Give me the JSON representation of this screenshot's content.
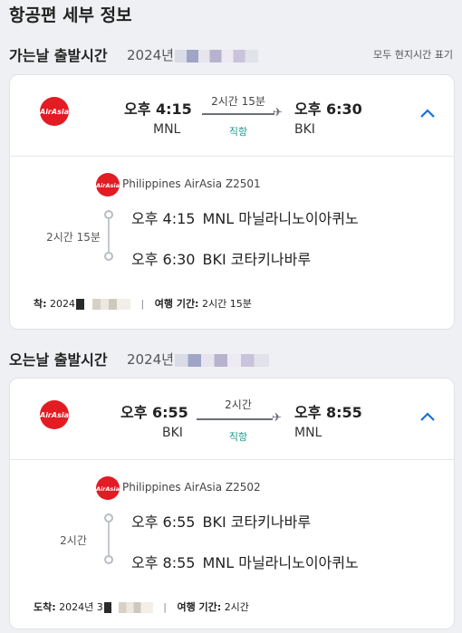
{
  "page": {
    "title": "항공편 세부 정보"
  },
  "timezone_note": "모두 현지시간 표기",
  "outbound": {
    "section_label": "가는날 출발시간",
    "date_visible": "2024년",
    "summary": {
      "dep_time": "오후 4:15",
      "dep_code": "MNL",
      "duration": "2시간 15분",
      "stops": "직항",
      "arr_time": "오후 6:30",
      "arr_code": "BKI"
    },
    "detail": {
      "airline": "Philippines AirAsia Z2501",
      "duration": "2시간 15분",
      "dep_time": "오후 4:15",
      "dep_place": "MNL 마닐라니노이아퀴노",
      "arr_time": "오후 6:30",
      "arr_place": "BKI 코타키나바루",
      "arrival_label": "착:",
      "arrival_date": "2024",
      "travel_label": "여행 기간:",
      "travel_time": "2시간 15분"
    }
  },
  "inbound": {
    "section_label": "오는날 출발시간",
    "date_visible": "2024년",
    "summary": {
      "dep_time": "오후 6:55",
      "dep_code": "BKI",
      "duration": "2시간",
      "stops": "직항",
      "arr_time": "오후 8:55",
      "arr_code": "MNL"
    },
    "detail": {
      "airline": "Philippines AirAsia Z2502",
      "duration": "2시간",
      "dep_time": "오후 6:55",
      "dep_place": "BKI 코타키나바루",
      "arr_time": "오후 8:55",
      "arr_place": "MNL 마닐라니노이아퀴노",
      "arrival_label": "도착:",
      "arrival_date": "2024년 3",
      "travel_label": "여행 기간:",
      "travel_time": "2시간"
    }
  },
  "icons": {
    "airline_logo": "airasia-logo-icon",
    "plane": "plane-icon",
    "collapse": "chevron-up-icon"
  },
  "colors": {
    "airline_red": "#e31b23",
    "accent_blue": "#1a6fd6",
    "direct_teal": "#1a9a8a"
  }
}
